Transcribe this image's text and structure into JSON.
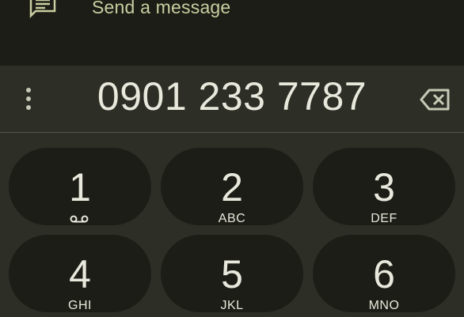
{
  "message": {
    "icon": "message-icon",
    "label": "Send a message"
  },
  "dial": {
    "more_icon": "more-vert-icon",
    "number": "0901 233 7787",
    "backspace_icon": "backspace-icon"
  },
  "keys": [
    {
      "digit": "1",
      "letters": "",
      "icon": "voicemail-icon"
    },
    {
      "digit": "2",
      "letters": "ABC"
    },
    {
      "digit": "3",
      "letters": "DEF"
    },
    {
      "digit": "4",
      "letters": "GHI"
    },
    {
      "digit": "5",
      "letters": "JKL"
    },
    {
      "digit": "6",
      "letters": "MNO"
    }
  ],
  "colors": {
    "background": "#1c1d16",
    "panel": "#2d2e26",
    "accent": "#c9cea0",
    "text": "#e8e8dc"
  }
}
